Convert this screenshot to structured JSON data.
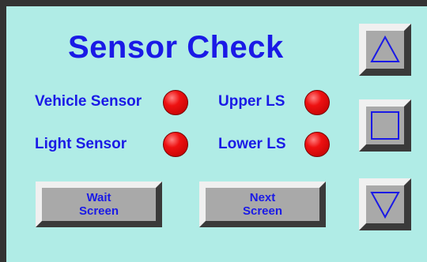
{
  "panel": {
    "title": "Sensor Check"
  },
  "sensors": [
    {
      "label": "Vehicle Sensor",
      "status_color": "#e01010"
    },
    {
      "label": "Light Sensor",
      "status_color": "#e01010"
    },
    {
      "label": "Upper LS",
      "status_color": "#e01010"
    },
    {
      "label": "Lower LS",
      "status_color": "#e01010"
    }
  ],
  "buttons": {
    "wait_line1": "Wait",
    "wait_line2": "Screen",
    "next_line1": "Next",
    "next_line2": "Screen"
  },
  "nav_icons": {
    "up": "triangle-up-icon",
    "home": "square-icon",
    "down": "triangle-down-icon"
  },
  "colors": {
    "background": "#b0ece6",
    "text": "#1a1ae6",
    "button_face": "#a9a9a9"
  }
}
